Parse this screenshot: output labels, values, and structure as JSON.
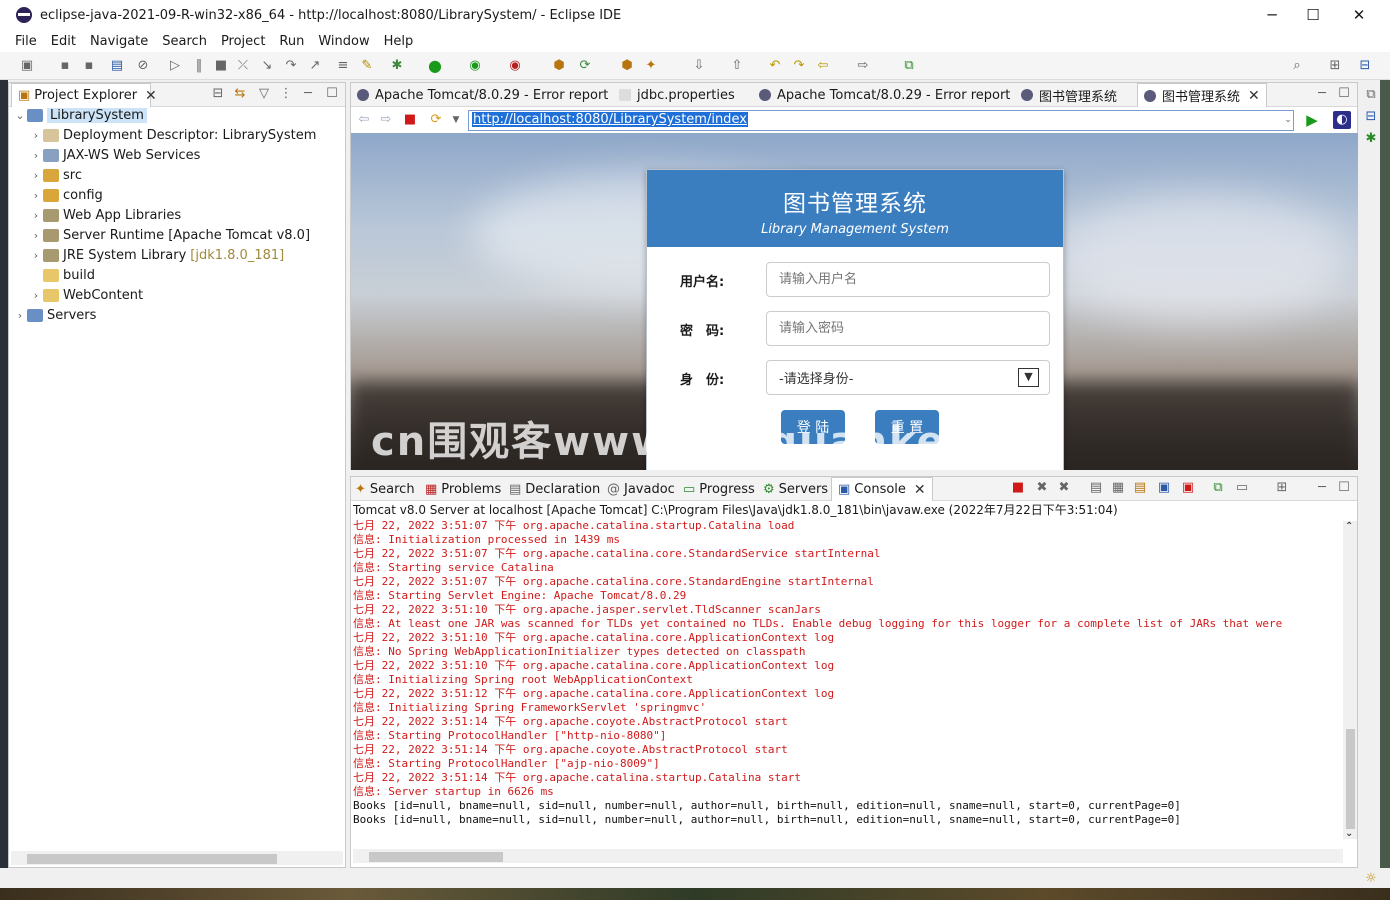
{
  "window": {
    "title": "eclipse-java-2021-09-R-win32-x86_64 - http://localhost:8080/LibrarySystem/ - Eclipse IDE",
    "minimize": "─",
    "maximize": "☐",
    "close": "✕"
  },
  "menu": [
    "File",
    "Edit",
    "Navigate",
    "Search",
    "Project",
    "Run",
    "Window",
    "Help"
  ],
  "project_explorer": {
    "tab_label": "Project Explorer",
    "items": [
      {
        "label": "LibrarySystem",
        "selected": true
      },
      {
        "label": "Deployment Descriptor: LibrarySystem"
      },
      {
        "label": "JAX-WS Web Services"
      },
      {
        "label": "src"
      },
      {
        "label": "config"
      },
      {
        "label": "Web App Libraries"
      },
      {
        "label": "Server Runtime [Apache Tomcat v8.0]"
      },
      {
        "label": "JRE System Library",
        "suffix": "[jdk1.8.0_181]"
      },
      {
        "label": "build"
      },
      {
        "label": "WebContent"
      },
      {
        "label": "Servers"
      }
    ]
  },
  "editor_tabs": [
    {
      "label": "Apache Tomcat/8.0.29 - Error report"
    },
    {
      "label": "jdbc.properties"
    },
    {
      "label": "Apache Tomcat/8.0.29 - Error report"
    },
    {
      "label": "图书管理系统"
    },
    {
      "label": "图书管理系统",
      "active": true
    }
  ],
  "browser": {
    "url": "http://localhost:8080/LibrarySystem/index"
  },
  "login": {
    "title": "图书管理系统",
    "subtitle": "Library Management System",
    "username_label": "用户名:",
    "username_placeholder": "请输入用户名",
    "password_label": "密　码:",
    "password_placeholder": "请输入密码",
    "role_label": "身　份:",
    "role_value": "-请选择身份-",
    "login_button": "登 陆",
    "reset_button": "重 置"
  },
  "watermark": "cn围观客www.weiguanke.cn",
  "bottom_tabs": [
    {
      "label": "Search"
    },
    {
      "label": "Problems"
    },
    {
      "label": "Declaration"
    },
    {
      "label": "Javadoc"
    },
    {
      "label": "Progress"
    },
    {
      "label": "Servers"
    },
    {
      "label": "Console",
      "active": true
    }
  ],
  "console": {
    "header": "Tomcat v8.0 Server at localhost [Apache Tomcat] C:\\Program Files\\Java\\jdk1.8.0_181\\bin\\javaw.exe  (2022年7月22日下午3:51:04)",
    "lines": [
      {
        "text": "七月 22, 2022 3:51:07 下午 org.apache.catalina.startup.Catalina load",
        "color": "red"
      },
      {
        "text": "信息: Initialization processed in 1439 ms",
        "color": "red"
      },
      {
        "text": "七月 22, 2022 3:51:07 下午 org.apache.catalina.core.StandardService startInternal",
        "color": "red"
      },
      {
        "text": "信息: Starting service Catalina",
        "color": "red"
      },
      {
        "text": "七月 22, 2022 3:51:07 下午 org.apache.catalina.core.StandardEngine startInternal",
        "color": "red"
      },
      {
        "text": "信息: Starting Servlet Engine: Apache Tomcat/8.0.29",
        "color": "red"
      },
      {
        "text": "七月 22, 2022 3:51:10 下午 org.apache.jasper.servlet.TldScanner scanJars",
        "color": "red"
      },
      {
        "text": "信息: At least one JAR was scanned for TLDs yet contained no TLDs. Enable debug logging for this logger for a complete list of JARs that were",
        "color": "red"
      },
      {
        "text": "七月 22, 2022 3:51:10 下午 org.apache.catalina.core.ApplicationContext log",
        "color": "red"
      },
      {
        "text": "信息: No Spring WebApplicationInitializer types detected on classpath",
        "color": "red"
      },
      {
        "text": "七月 22, 2022 3:51:10 下午 org.apache.catalina.core.ApplicationContext log",
        "color": "red"
      },
      {
        "text": "信息: Initializing Spring root WebApplicationContext",
        "color": "red"
      },
      {
        "text": "七月 22, 2022 3:51:12 下午 org.apache.catalina.core.ApplicationContext log",
        "color": "red"
      },
      {
        "text": "信息: Initializing Spring FrameworkServlet 'springmvc'",
        "color": "red"
      },
      {
        "text": "七月 22, 2022 3:51:14 下午 org.apache.coyote.AbstractProtocol start",
        "color": "red"
      },
      {
        "text": "信息: Starting ProtocolHandler [\"http-nio-8080\"]",
        "color": "red"
      },
      {
        "text": "七月 22, 2022 3:51:14 下午 org.apache.coyote.AbstractProtocol start",
        "color": "red"
      },
      {
        "text": "信息: Starting ProtocolHandler [\"ajp-nio-8009\"]",
        "color": "red"
      },
      {
        "text": "七月 22, 2022 3:51:14 下午 org.apache.catalina.startup.Catalina start",
        "color": "red"
      },
      {
        "text": "信息: Server startup in 6626 ms",
        "color": "red"
      },
      {
        "text": "Books [id=null, bname=null, sid=null, number=null, author=null, birth=null, edition=null, sname=null, start=0, currentPage=0]",
        "color": "black"
      },
      {
        "text": "Books [id=null, bname=null, sid=null, number=null, author=null, birth=null, edition=null, sname=null, start=0, currentPage=0]",
        "color": "black"
      }
    ]
  },
  "colors": {
    "login_header": "#3a7ec0",
    "console_error": "#d01a1a",
    "url_selection": "#1f6fd8"
  }
}
